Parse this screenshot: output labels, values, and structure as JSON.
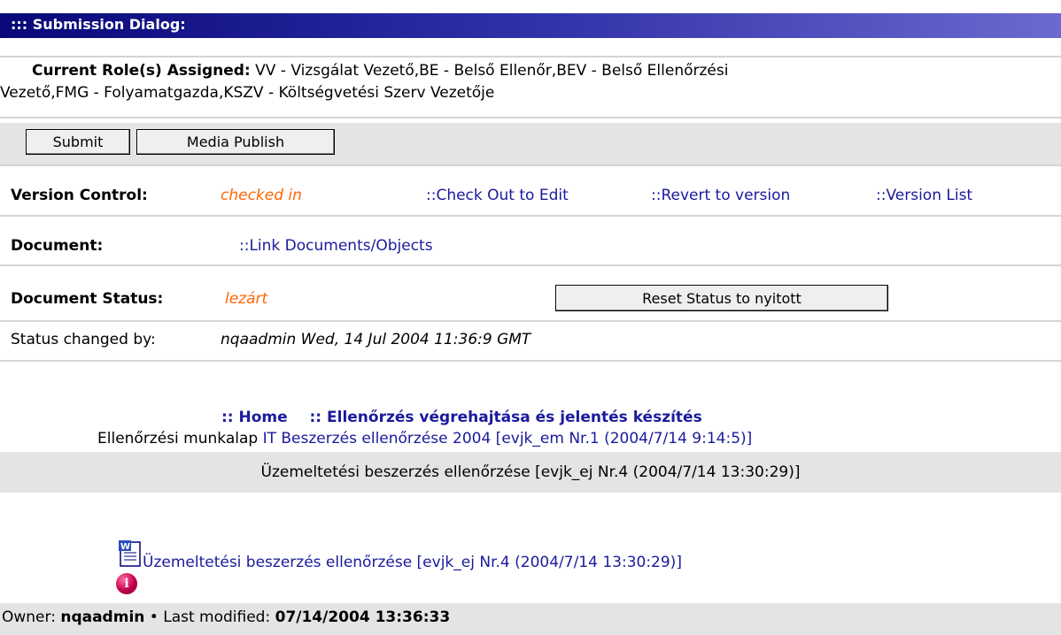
{
  "dialog_title": "::: Submission Dialog:",
  "roles": {
    "label": "Current Role(s) Assigned:",
    "line1": "VV - Vizsgálat Vezető,BE - Belső Ellenőr,BEV - Belső Ellenőrzési",
    "line2": "Vezető,FMG - Folyamatgazda,KSZV - Költségvetési Szerv Vezetője"
  },
  "buttons": {
    "submit": "Submit",
    "media_publish": "Media Publish"
  },
  "version_control": {
    "label": "Version Control:",
    "state": "checked in",
    "check_out": "::Check Out to Edit",
    "revert": "::Revert to version",
    "version_list": "::Version List"
  },
  "document": {
    "label": "Document:",
    "link": "::Link Documents/Objects"
  },
  "document_status": {
    "label": "Document Status:",
    "value": "lezárt",
    "reset_button": "Reset Status to nyitott",
    "changed_by_label": "Status changed by:",
    "changed_by_value": "nqaadmin Wed, 14 Jul 2004 11:36:9 GMT"
  },
  "nav": {
    "home": ":: Home",
    "section": ":: Ellenőrzés végrehajtása és jelentés készítés",
    "worksheet_label": "Ellenőrzési munkalap",
    "worksheet_link": "IT Beszerzés ellenőrzése 2004 [evjk_em Nr.1 (2004/7/14 9:14:5)]"
  },
  "current_item": "Üzemeltetési beszerzés ellenőrzése [evjk_ej Nr.4 (2004/7/14 13:30:29)]",
  "document_link": "Üzemeltetési beszerzés ellenőrzése [evjk_ej Nr.4 (2004/7/14 13:30:29)]",
  "icons": {
    "info": "info-icon",
    "word_doc": "word-document-icon",
    "info_glyph": "i",
    "word_glyph": "W"
  },
  "footer": {
    "owner_label": "Owner:",
    "owner": "nqaadmin",
    "separator": "•",
    "modified_label": "Last modified:",
    "modified": "07/14/2004 13:36:33"
  },
  "colors": {
    "title_bar": "#08087a",
    "link": "#1a1a9c",
    "status_orange": "#ff6600",
    "panel_gray": "#e4e4e4",
    "info_icon": "#c2004c"
  }
}
